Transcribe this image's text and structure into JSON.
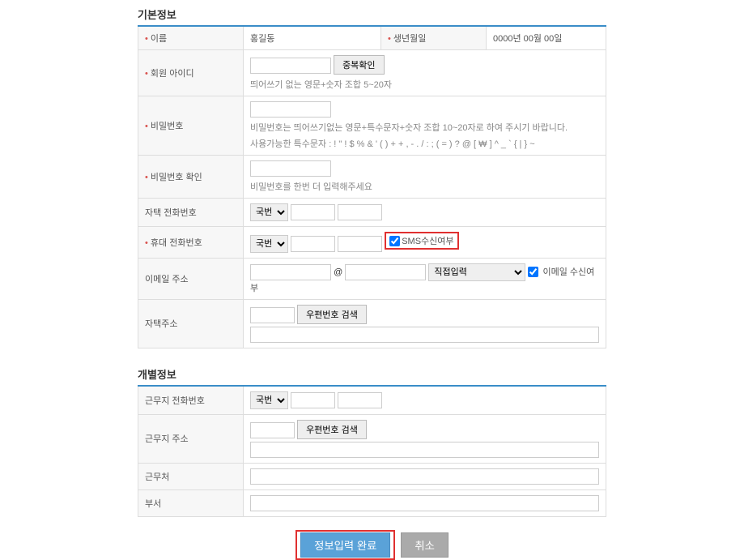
{
  "basicInfo": {
    "title": "기본정보",
    "name": {
      "label": "이름",
      "value": "홍길동"
    },
    "birth": {
      "label": "생년월일",
      "value": "0000년 00월 00일"
    },
    "memberId": {
      "label": "회원 아이디",
      "checkDup": "중복확인",
      "hint": "띄어쓰기 없는 영문+숫자 조합 5~20자"
    },
    "password": {
      "label": "비밀번호",
      "hint1": "비밀번호는 띄어쓰기없는 영문+특수문자+숫자 조합 10~20자로 하여 주시기 바랍니다.",
      "hint2": "사용가능한 특수문자 : ! \" ! $ % & ' ( ) + + , - . / : ; ( = ) ? @ [ ₩ ] ^ _ ` { | } ~"
    },
    "passwordConfirm": {
      "label": "비밀번호 확인",
      "hint": "비밀번호를 한번 더 입력해주세요"
    },
    "homePhone": {
      "label": "자택 전화번호",
      "selectLabel": "국번"
    },
    "mobilePhone": {
      "label": "휴대 전화번호",
      "selectLabel": "국번",
      "smsLabel": "SMS수신여부"
    },
    "email": {
      "label": "이메일 주소",
      "at": "@",
      "directInput": "직접입력",
      "receiveLabel": "이메일 수신여부"
    },
    "address": {
      "label": "자택주소",
      "searchBtn": "우편번호 검색"
    }
  },
  "individualInfo": {
    "title": "개별정보",
    "workPhone": {
      "label": "근무지 전화번호",
      "selectLabel": "국번"
    },
    "workAddress": {
      "label": "근무지 주소",
      "searchBtn": "우편번호 검색"
    },
    "workplace": {
      "label": "근무처"
    },
    "department": {
      "label": "부서"
    }
  },
  "buttons": {
    "submit": "정보입력 완료",
    "cancel": "취소"
  }
}
